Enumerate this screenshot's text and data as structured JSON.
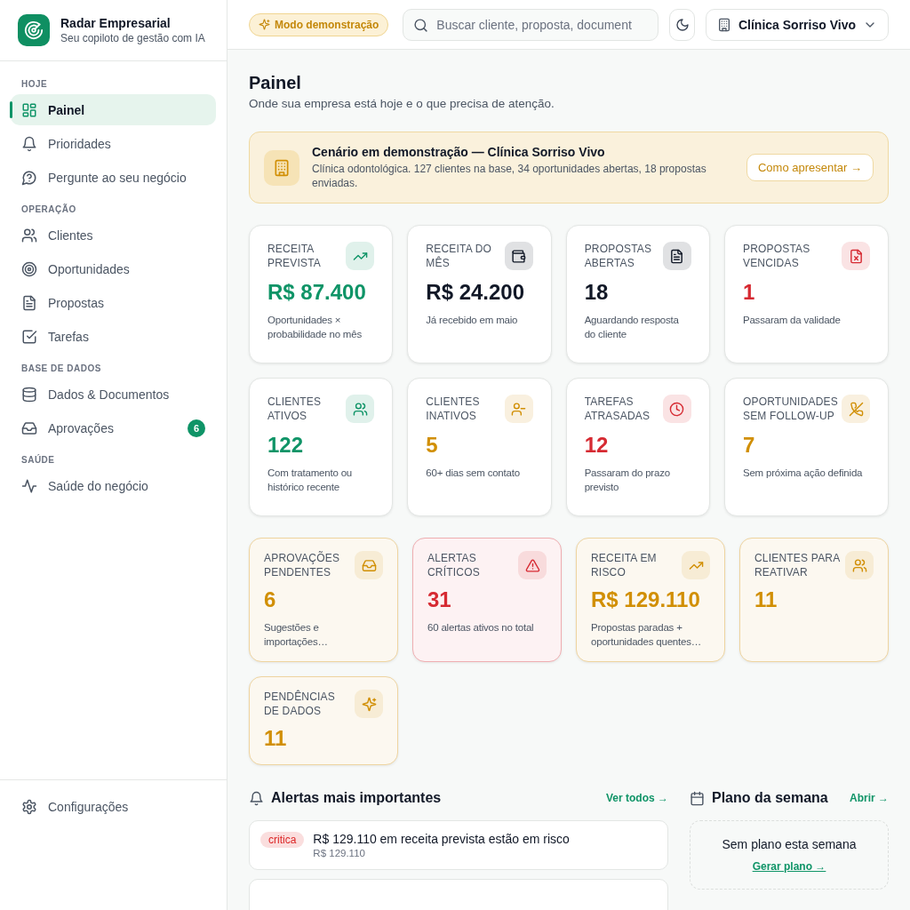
{
  "brand": {
    "name": "Radar Empresarial",
    "tagline": "Seu copiloto de gestão com IA"
  },
  "sidebar": {
    "sections": [
      {
        "label": "HOJE",
        "items": [
          {
            "label": "Painel",
            "selected": true
          },
          {
            "label": "Prioridades",
            "selected": false
          },
          {
            "label": "Pergunte ao seu negócio",
            "selected": false
          }
        ]
      },
      {
        "label": "OPERAÇÃO",
        "items": [
          {
            "label": "Clientes",
            "selected": false
          },
          {
            "label": "Oportunidades",
            "selected": false
          },
          {
            "label": "Propostas",
            "selected": false
          },
          {
            "label": "Tarefas",
            "selected": false
          }
        ]
      },
      {
        "label": "BASE DE DADOS",
        "items": [
          {
            "label": "Dados & Documentos",
            "selected": false
          },
          {
            "label": "Aprovações",
            "selected": false,
            "badge": "6"
          }
        ]
      },
      {
        "label": "SAÚDE",
        "items": [
          {
            "label": "Saúde do negócio",
            "selected": false
          }
        ]
      }
    ],
    "footer_item": {
      "label": "Configurações",
      "selected": false
    }
  },
  "topbar": {
    "demo_badge": "Modo demonstração",
    "search": {
      "placeholder": "Buscar cliente, proposta, document"
    },
    "company": "Clínica Sorriso Vivo"
  },
  "page": {
    "title": "Painel",
    "subtitle": "Onde sua empresa está hoje e o que precisa de atenção."
  },
  "banner": {
    "title": "Cenário em demonstração — Clínica Sorriso Vivo",
    "description": "Clínica odontológica. 127 clientes na base, 34 oportunidades abertas, 18 propostas enviadas.",
    "button": "Como apresentar →"
  },
  "metrics": [
    {
      "label": "RECEITA PREVISTA",
      "value": "R$ 87.400",
      "note": "Oportunidades × probabilidade no mês",
      "color": "#0f9467",
      "highlighted": false
    },
    {
      "label": "RECEITA DO MÊS",
      "value": "R$ 24.200",
      "note": "Já recebido em maio",
      "color": "#111827",
      "highlighted": false
    },
    {
      "label": "PROPOSTAS ABERTAS",
      "value": "18",
      "note": "Aguardando resposta do cliente",
      "color": "#111827",
      "highlighted": false
    },
    {
      "label": "PROPOSTAS VENCIDAS",
      "value": "1",
      "note": "Passaram da validade",
      "color": "#d62a32",
      "highlighted": false
    },
    {
      "label": "CLIENTES ATIVOS",
      "value": "122",
      "note": "Com tratamento ou histórico recente",
      "color": "#0f9467",
      "highlighted": false
    },
    {
      "label": "CLIENTES INATIVOS",
      "value": "5",
      "note": "60+ dias sem contato",
      "color": "#d18f05",
      "highlighted": false
    },
    {
      "label": "TAREFAS ATRASADAS",
      "value": "12",
      "note": "Passaram do prazo previsto",
      "color": "#d62a32",
      "highlighted": false
    },
    {
      "label": "OPORTUNIDADES SEM FOLLOW-UP",
      "value": "7",
      "note": "Sem próxima ação definida",
      "color": "#d18f05",
      "highlighted": false
    },
    {
      "label": "APROVAÇÕES PENDENTES",
      "value": "6",
      "note": "Sugestões e importações…",
      "color": "#d18f05",
      "highlighted": true
    },
    {
      "label": "ALERTAS CRÍTICOS",
      "value": "31",
      "note": "60 alertas ativos no total",
      "color": "#d62a32",
      "highlighted": true
    },
    {
      "label": "RECEITA EM RISCO",
      "value": "R$ 129.110",
      "note": "Propostas paradas + oportunidades quentes…",
      "color": "#d18f05",
      "highlighted": true
    },
    {
      "label": "CLIENTES PARA REATIVAR",
      "value": "11",
      "color": "#d18f05",
      "highlighted": true
    },
    {
      "label": "PENDÊNCIAS DE DADOS",
      "value": "11",
      "color": "#d18f05",
      "highlighted": true
    }
  ],
  "alerts": {
    "title": "Alertas mais importantes",
    "link": "Ver todos →",
    "items": [
      {
        "severity": "critica",
        "color": "#dc2626",
        "title": "R$ 129.110 em receita prevista estão em risco",
        "detail": "R$ 129.110"
      }
    ]
  },
  "plan": {
    "title": "Plano da semana",
    "link": "Abrir →",
    "empty_text": "Sem plano esta semana",
    "action": "Gerar plano →"
  }
}
